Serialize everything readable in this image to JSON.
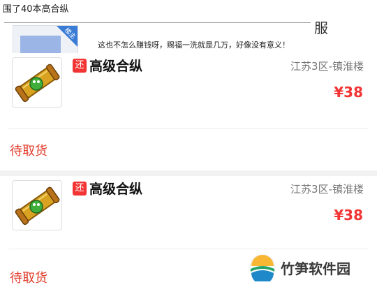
{
  "top_post": {
    "title": "围了40本高合纵",
    "right_char": "服",
    "corner_badge": "楼主",
    "description": "这也不怎么赚钱呀，赐福一洗就是几万，好像没有意义！"
  },
  "orders": [
    {
      "tag": "还",
      "item_name": "高级合纵",
      "server": "江苏3区-镇淮楼",
      "price": "¥38",
      "status": "待取货",
      "icon": "scroll-icon"
    },
    {
      "tag": "还",
      "item_name": "高级合纵",
      "server": "江苏3区-镇淮楼",
      "price": "¥38",
      "status": "待取货",
      "icon": "scroll-icon"
    }
  ],
  "watermark": {
    "text": "竹笋软件园"
  },
  "colors": {
    "accent_red": "#f23434",
    "status_red": "#e23b2a",
    "badge_blue": "#3a7bd5"
  }
}
